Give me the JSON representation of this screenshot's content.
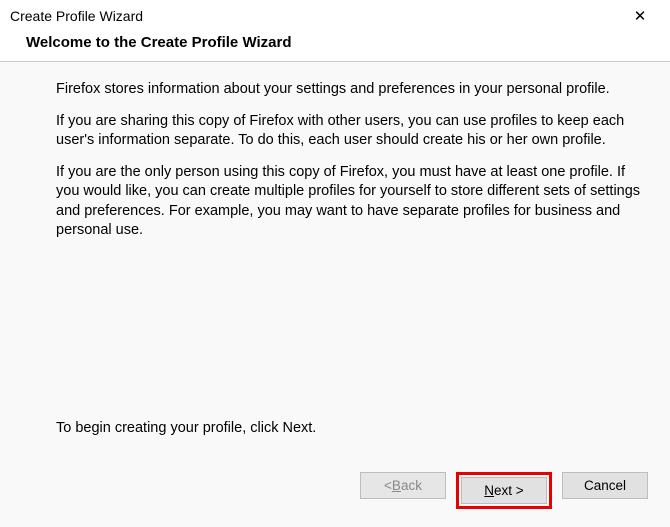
{
  "window": {
    "title": "Create Profile Wizard"
  },
  "header": {
    "title": "Welcome to the Create Profile Wizard"
  },
  "body": {
    "para1": "Firefox stores information about your settings and preferences in your personal profile.",
    "para2": "If you are sharing this copy of Firefox with other users, you can use profiles to keep each user's information separate. To do this, each user should create his or her own profile.",
    "para3": "If you are the only person using this copy of Firefox, you must have at least one profile. If you would like, you can create multiple profiles for yourself to store different sets of settings and preferences. For example, you may want to have separate profiles for business and personal use.",
    "begin": "To begin creating your profile, click Next."
  },
  "buttons": {
    "back_prefix": "< ",
    "back_letter": "B",
    "back_rest": "ack",
    "next_letter": "N",
    "next_rest": "ext >",
    "cancel": "Cancel"
  }
}
